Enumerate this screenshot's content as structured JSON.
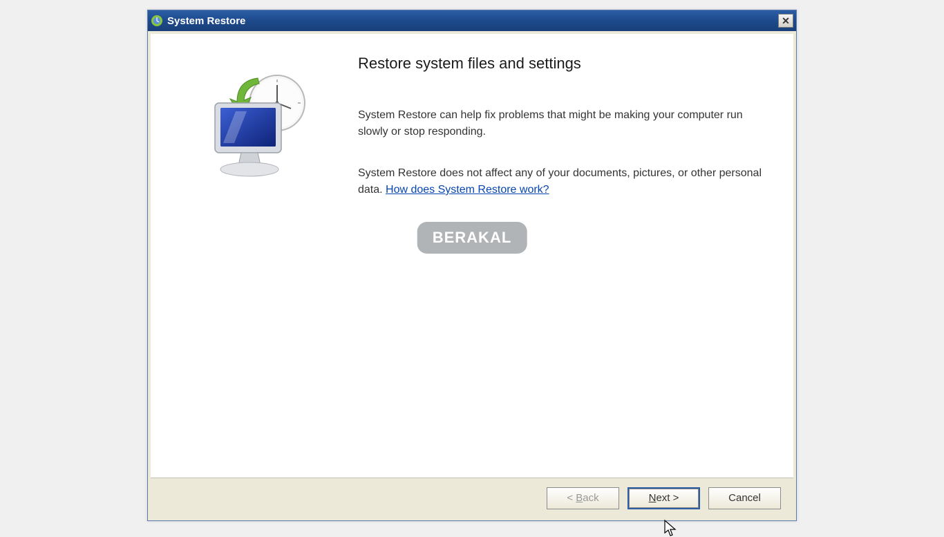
{
  "window": {
    "title": "System Restore"
  },
  "content": {
    "heading": "Restore system files and settings",
    "paragraph1": "System Restore can help fix problems that might be making your computer run slowly or stop responding.",
    "paragraph2_prefix": "System Restore does not affect any of your documents, pictures, or other personal data. ",
    "help_link": "How does System Restore work?"
  },
  "buttons": {
    "back": "< Back",
    "next": "Next >",
    "cancel": "Cancel"
  },
  "watermark": "BERAKAL"
}
